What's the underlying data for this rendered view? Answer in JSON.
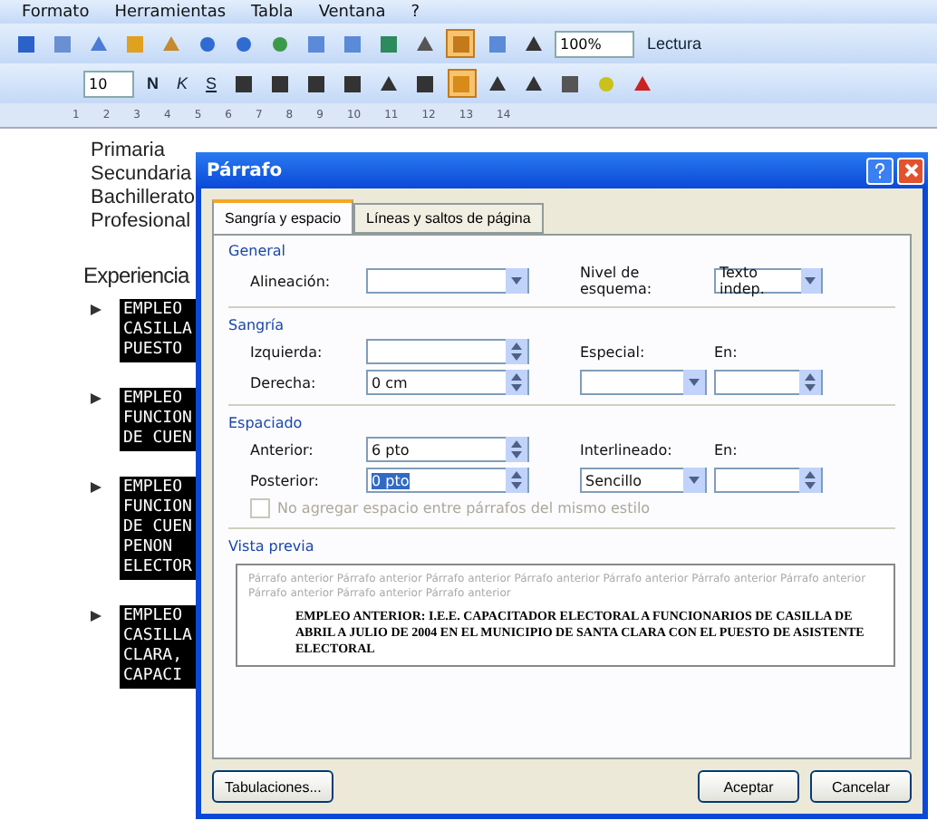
{
  "menu_bar": {
    "items": [
      "Formato",
      "Herramientas",
      "Tabla",
      "Ventana",
      "?"
    ]
  },
  "standard_toolbar": {
    "zoom": "100%",
    "reading_button": "Lectura"
  },
  "format_toolbar": {
    "font_size": "10",
    "bold": "N",
    "italic": "K",
    "underline": "S"
  },
  "ruler": {
    "marks": [
      "1",
      "2",
      "3",
      "4",
      "5",
      "6",
      "7",
      "8",
      "9",
      "10",
      "11",
      "12",
      "13",
      "14"
    ]
  },
  "document": {
    "education": [
      "Primaria",
      "Secundaria",
      "Bachillerato",
      "Profesional"
    ],
    "heading": "Experiencia",
    "entries": [
      {
        "lines": [
          "EMPLEO",
          "CASILLA",
          "PUESTO"
        ]
      },
      {
        "lines": [
          "EMPLEO",
          "FUNCION",
          "DE CUEN"
        ]
      },
      {
        "lines": [
          "EMPLEO",
          "FUNCION",
          "DE CUEN",
          "PENON",
          "ELECTOR"
        ]
      },
      {
        "lines": [
          "EMPLEO",
          "CASILLA",
          "CLARA,",
          "CAPACI"
        ]
      }
    ]
  },
  "dialog": {
    "title": "Párrafo",
    "tabs": [
      {
        "label": "Sangría y espacio",
        "selected": true
      },
      {
        "label": "Líneas y saltos de página",
        "selected": false
      }
    ],
    "general": {
      "heading": "General",
      "alignment_label": "Alineación:",
      "outline_label": "Nivel de esquema:",
      "outline_value": "Texto indep."
    },
    "indent": {
      "heading": "Sangría",
      "left_label": "Izquierda:",
      "right_label": "Derecha:",
      "right_value": "0 cm",
      "special_label": "Especial:",
      "by_label": "En:"
    },
    "spacing": {
      "heading": "Espaciado",
      "before_label": "Anterior:",
      "before_value": "6 pto",
      "after_label": "Posterior:",
      "after_value": "0 pto",
      "line_label": "Interlineado:",
      "line_value": "Sencillo",
      "at_label": "En:",
      "no_space_label": "No agregar espacio entre párrafos del mismo estilo",
      "no_space_checked": false,
      "no_space_disabled": true
    },
    "preview": {
      "heading": "Vista previa",
      "previous_text": "Párrafo anterior Párrafo anterior Párrafo anterior Párrafo anterior Párrafo anterior Párrafo anterior Párrafo anterior Párrafo anterior Párrafo anterior Párrafo anterior",
      "sample_text": "EMPLEO ANTERIOR: I.E.E. CAPACITADOR ELECTORAL A FUNCIONARIOS DE CASILLA DE ABRIL A JULIO DE 2004 EN EL MUNICIPIO DE SANTA CLARA CON EL PUESTO DE ASISTENTE ELECTORAL"
    },
    "buttons": {
      "tabs": "Tabulaciones...",
      "ok": "Aceptar",
      "cancel": "Cancelar"
    }
  }
}
